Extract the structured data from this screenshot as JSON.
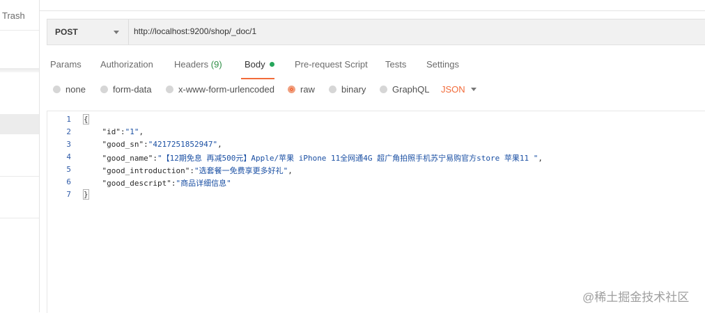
{
  "sidebar": {
    "trash_label": "Trash"
  },
  "request": {
    "method": "POST",
    "url": "http://localhost:9200/shop/_doc/1"
  },
  "tabs": [
    {
      "label": "Params"
    },
    {
      "label": "Authorization"
    },
    {
      "label": "Headers",
      "count": "(9)"
    },
    {
      "label": "Body"
    },
    {
      "label": "Pre-request Script"
    },
    {
      "label": "Tests"
    },
    {
      "label": "Settings"
    }
  ],
  "body_types": [
    {
      "label": "none"
    },
    {
      "label": "form-data"
    },
    {
      "label": "x-www-form-urlencoded"
    },
    {
      "label": "raw",
      "selected": true
    },
    {
      "label": "binary"
    },
    {
      "label": "GraphQL"
    }
  ],
  "format": "JSON",
  "editor": {
    "line_numbers": [
      "1",
      "2",
      "3",
      "4",
      "5",
      "6",
      "7"
    ],
    "lines": [
      {
        "open": "{"
      },
      {
        "key": "\"id\"",
        "val": "\"1\"",
        "tail": ","
      },
      {
        "key": "\"good_sn\"",
        "val": "\"4217251852947\"",
        "tail": ","
      },
      {
        "key": "\"good_name\"",
        "val": "\"【12期免息 再减500元】Apple/苹果 iPhone 11全网通4G 超广角拍照手机苏宁易购官方store 苹果11 \"",
        "tail": ","
      },
      {
        "key": "\"good_introduction\"",
        "val": "\"选套餐一免费享更多好礼\"",
        "tail": ","
      },
      {
        "key": "\"good_descript\"",
        "val": "\"商品详细信息\"",
        "tail": ""
      },
      {
        "close": "}"
      }
    ]
  },
  "watermark": "@稀土掘金技术社区",
  "colors": {
    "accent": "#f26b3a",
    "dot": "#26a65b",
    "count": "#2f8f46"
  }
}
